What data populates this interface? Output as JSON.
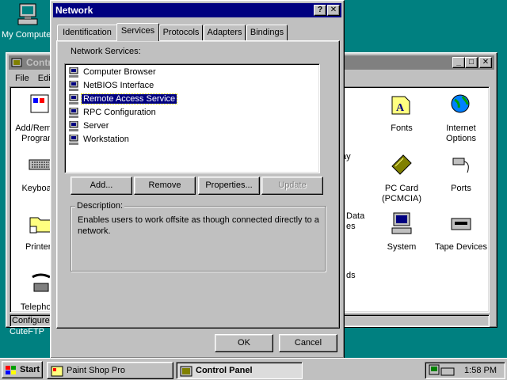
{
  "desktop": {
    "icons": [
      {
        "label": "My Computer"
      },
      {
        "label": "CuteFTP"
      }
    ]
  },
  "control_panel": {
    "title": "Control Panel",
    "menu": [
      "File",
      "Edit"
    ],
    "status": "Configures",
    "left_items": [
      "Add/Remove Programs",
      "Keyboard",
      "Printers",
      "Telephony"
    ],
    "items": [
      {
        "label": "Fonts",
        "icon": "fonts-icon"
      },
      {
        "label": "Internet Options",
        "icon": "internet-options-icon"
      },
      {
        "label": "PC Card (PCMCIA)",
        "icon": "pc-card-icon"
      },
      {
        "label": "Ports",
        "icon": "ports-icon"
      },
      {
        "label": "System",
        "icon": "system-icon"
      },
      {
        "label": "Tape Devices",
        "icon": "tape-devices-icon"
      }
    ],
    "partial_labels": [
      "ay",
      "Data",
      "es",
      "ds"
    ]
  },
  "network_dialog": {
    "title": "Network",
    "help_button": "?",
    "close_button": "✕",
    "tabs": [
      {
        "label": "Identification",
        "active": false
      },
      {
        "label": "Services",
        "active": true
      },
      {
        "label": "Protocols",
        "active": false
      },
      {
        "label": "Adapters",
        "active": false
      },
      {
        "label": "Bindings",
        "active": false
      }
    ],
    "services_label": "Network Services:",
    "services": [
      {
        "label": "Computer Browser",
        "selected": false
      },
      {
        "label": "NetBIOS Interface",
        "selected": false
      },
      {
        "label": "Remote Access Service",
        "selected": true
      },
      {
        "label": "RPC Configuration",
        "selected": false
      },
      {
        "label": "Server",
        "selected": false
      },
      {
        "label": "Workstation",
        "selected": false
      }
    ],
    "buttons": {
      "add": "Add...",
      "remove": "Remove",
      "properties": "Properties...",
      "update": "Update"
    },
    "description_label": "Description:",
    "description_text": "Enables users to work offsite as though connected directly to a network.",
    "ok": "OK",
    "cancel": "Cancel"
  },
  "taskbar": {
    "start": "Start",
    "tasks": [
      {
        "label": "Paint Shop Pro",
        "active": false
      },
      {
        "label": "Control Panel",
        "active": true
      }
    ],
    "clock": "1:58 PM"
  },
  "colors": {
    "desktop": "#008080",
    "active_title": "#000080",
    "inactive_title": "#808080",
    "face": "#c0c0c0"
  }
}
